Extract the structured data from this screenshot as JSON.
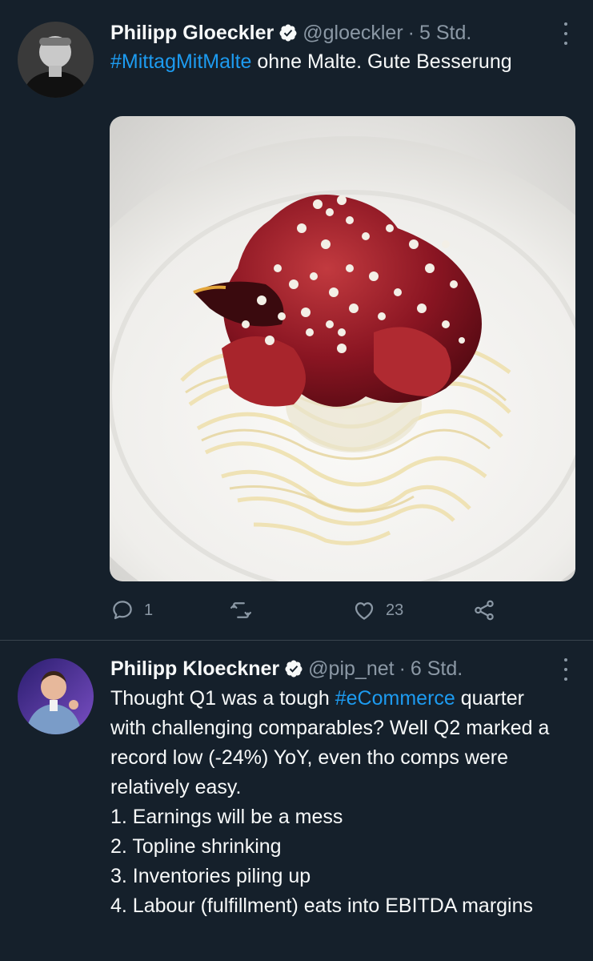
{
  "tweets": [
    {
      "author_name": "Philipp Gloeckler",
      "handle": "@gloeckler",
      "separator": "·",
      "time": "5 Std.",
      "hashtag": "#MittagMitMalte",
      "text_rest": " ohne Malte. Gute Besserung",
      "media_icon": "food-photo",
      "actions": {
        "reply_count": "1",
        "retweet_count": "",
        "like_count": "23"
      }
    },
    {
      "author_name": "Philipp Kloeckner",
      "handle": "@pip_net",
      "separator": "·",
      "time": "6 Std.",
      "text_before": "Thought Q1 was a tough ",
      "hashtag": "#eCommerce",
      "text_after": " quarter with challenging comparables? Well Q2 marked a record low (-24%) YoY, even tho comps were relatively easy.",
      "list": [
        "1. Earnings will be a mess",
        "2. Topline shrinking",
        "3. Inventories piling up",
        "4. Labour (fulfillment) eats into EBITDA margins"
      ]
    }
  ],
  "colors": {
    "background": "#15202b",
    "text": "#f7f9f9",
    "muted": "#8b98a5",
    "link": "#1d9bf0",
    "divider": "#38444d"
  }
}
